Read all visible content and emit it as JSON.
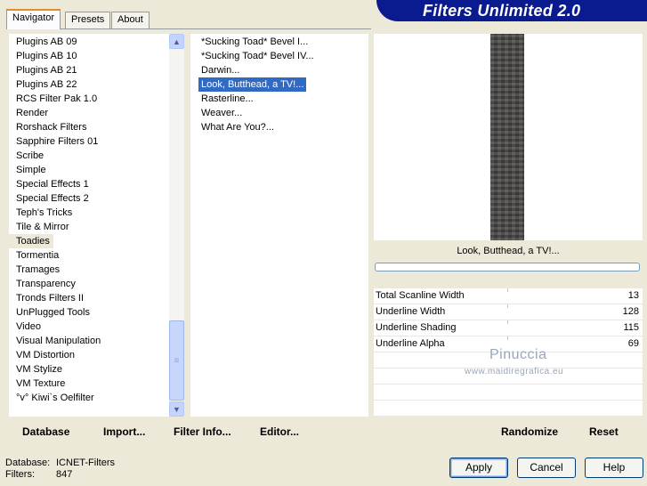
{
  "tabs": [
    {
      "label": "Navigator"
    },
    {
      "label": "Presets"
    },
    {
      "label": "About"
    }
  ],
  "banner_title": "Filters Unlimited 2.0",
  "categories": [
    "Plugins AB 09",
    "Plugins AB 10",
    "Plugins AB 21",
    "Plugins AB 22",
    "RCS Filter Pak 1.0",
    "Render",
    "Rorshack Filters",
    "Sapphire Filters 01",
    "Scribe",
    "Simple",
    "Special Effects 1",
    "Special Effects 2",
    "Teph's Tricks",
    "Tile & Mirror",
    "Toadies",
    "Tormentia",
    "Tramages",
    "Transparency",
    "Tronds Filters II",
    "UnPlugged Tools",
    "Video",
    "Visual Manipulation",
    "VM Distortion",
    "VM Stylize",
    "VM Texture",
    "°v° Kiwi`s Oelfilter"
  ],
  "selected_category": "Toadies",
  "filters": [
    "*Sucking Toad*  Bevel I...",
    "*Sucking Toad*  Bevel IV...",
    "Darwin...",
    "Look, Butthead, a TV!...",
    "Rasterline...",
    "Weaver...",
    "What Are You?..."
  ],
  "selected_filter": "Look, Butthead, a TV!...",
  "preview": {
    "title": "Look, Butthead, a TV!...",
    "progress": 0
  },
  "params": [
    {
      "label": "Total Scanline Width",
      "value": "13"
    },
    {
      "label": "Underline Width",
      "value": "128"
    },
    {
      "label": "Underline Shading",
      "value": "115"
    },
    {
      "label": "Underline Alpha",
      "value": "69"
    }
  ],
  "watermark": {
    "name": "Pinuccia",
    "site": "www.maidiregrafica.eu"
  },
  "actions": {
    "database": "Database",
    "import": "Import...",
    "filter_info": "Filter Info...",
    "editor": "Editor...",
    "randomize": "Randomize",
    "reset": "Reset"
  },
  "status": {
    "database_label": "Database:",
    "database_value": "ICNET-Filters",
    "filters_label": "Filters:",
    "filters_value": "847"
  },
  "buttons": {
    "apply": "Apply",
    "cancel": "Cancel",
    "help": "Help"
  }
}
